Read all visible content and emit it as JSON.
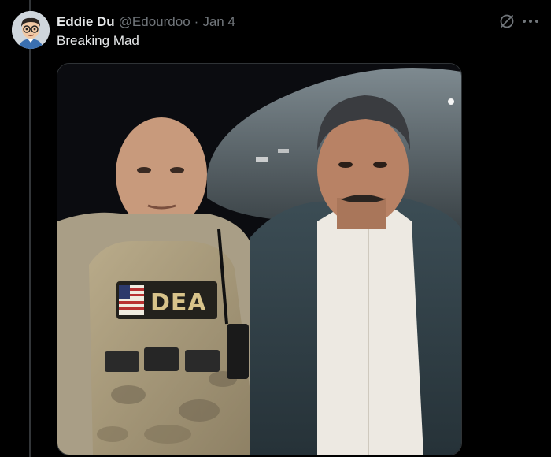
{
  "tweet": {
    "display_name": "Eddie Du",
    "handle": "@Edourdoo",
    "separator": "·",
    "date": "Jan 4",
    "text": "Breaking Mad"
  },
  "media": {
    "vest_patch": "DEA"
  },
  "icons": {
    "avatar": "cartoon-avatar",
    "grok": "grok-icon",
    "more": "more-icon"
  },
  "colors": {
    "background": "#000000",
    "primary_text": "#e7e9ea",
    "secondary_text": "#71767b"
  }
}
